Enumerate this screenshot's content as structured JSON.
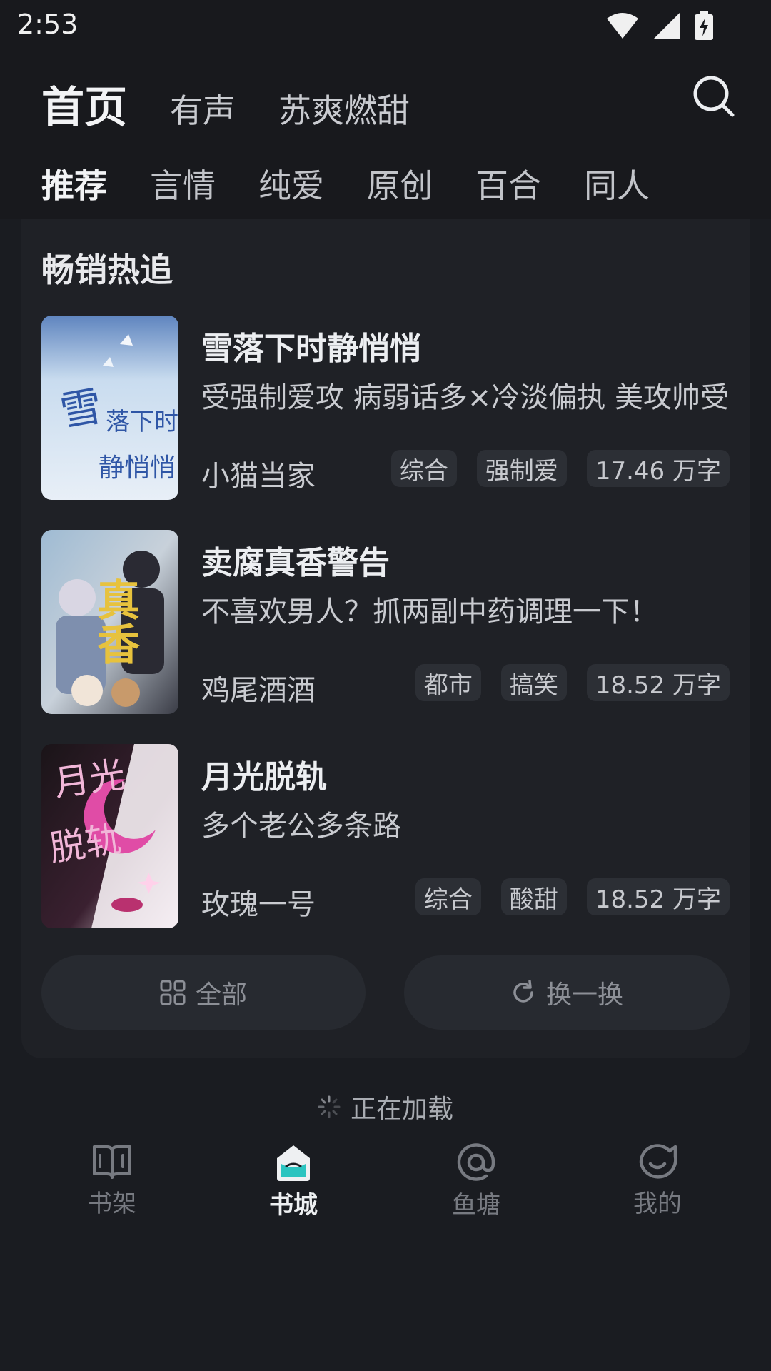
{
  "status": {
    "time": "2:53"
  },
  "header": {
    "top_tabs": [
      "首页",
      "有声",
      "苏爽燃甜"
    ],
    "sub_tabs": [
      "推荐",
      "言情",
      "纯爱",
      "原创",
      "百合",
      "同人"
    ]
  },
  "section": {
    "title": "畅销热追",
    "books": [
      {
        "title": "雪落下时静悄悄",
        "desc": "受强制爱攻 病弱话多×冷淡偏执 美攻帅受",
        "author": "小猫当家",
        "tags": [
          "综合",
          "强制爱",
          "17.46 万字"
        ],
        "cover_text": "雪落下时 静悄悄",
        "cover_colors": [
          "#c7d9ee",
          "#6d95cc",
          "#2f56a6"
        ]
      },
      {
        "title": "卖腐真香警告",
        "desc": "不喜欢男人？抓两副中药调理一下！",
        "author": "鸡尾酒酒",
        "tags": [
          "都市",
          "搞笑",
          "18.52 万字"
        ],
        "cover_text": "真香",
        "cover_colors": [
          "#86a5c2",
          "#e7c23d",
          "#2a2a33"
        ]
      },
      {
        "title": "月光脱轨",
        "desc": "多个老公多条路",
        "author": "玫瑰一号",
        "tags": [
          "综合",
          "酸甜",
          "18.52 万字"
        ],
        "cover_text": "月光 脱轨",
        "cover_colors": [
          "#121014",
          "#e04ca6",
          "#f5e9f2"
        ]
      }
    ],
    "buttons": {
      "all": "全部",
      "refresh": "换一换"
    }
  },
  "loading": "正在加载",
  "nav": {
    "items": [
      {
        "label": "书架",
        "icon": "bookshelf-icon"
      },
      {
        "label": "书城",
        "icon": "bookstore-icon"
      },
      {
        "label": "鱼塘",
        "icon": "at-icon"
      },
      {
        "label": "我的",
        "icon": "profile-icon"
      }
    ]
  },
  "colors": {
    "accent": "#2bc4c0",
    "background": "#1a1c21",
    "card": "#1f2126"
  }
}
